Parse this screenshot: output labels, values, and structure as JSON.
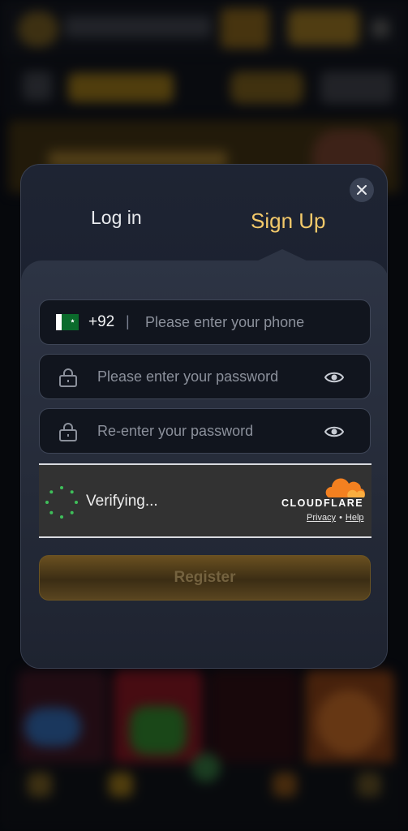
{
  "modal": {
    "tabs": {
      "login": "Log in",
      "signup": "Sign Up"
    },
    "active_tab": "signup",
    "close_icon": "close-icon"
  },
  "phone": {
    "country_flag": "pakistan-flag",
    "country_code": "+92",
    "separator": "|",
    "placeholder": "Please enter your phone"
  },
  "password": {
    "placeholder": "Please enter your password",
    "icon": "lock-icon",
    "toggle_icon": "eye-icon"
  },
  "repassword": {
    "placeholder": "Re-enter your password",
    "icon": "lock-icon",
    "toggle_icon": "eye-icon"
  },
  "captcha": {
    "status": "Verifying...",
    "brand": "CLOUDFLARE",
    "privacy": "Privacy",
    "dot": "•",
    "help": "Help"
  },
  "register": {
    "label": "Register"
  },
  "colors": {
    "accent": "#f3c96a",
    "modal_bg": "#1e2433",
    "cloudflare_orange": "#f38020",
    "spinner_green": "#3fbf5a"
  }
}
